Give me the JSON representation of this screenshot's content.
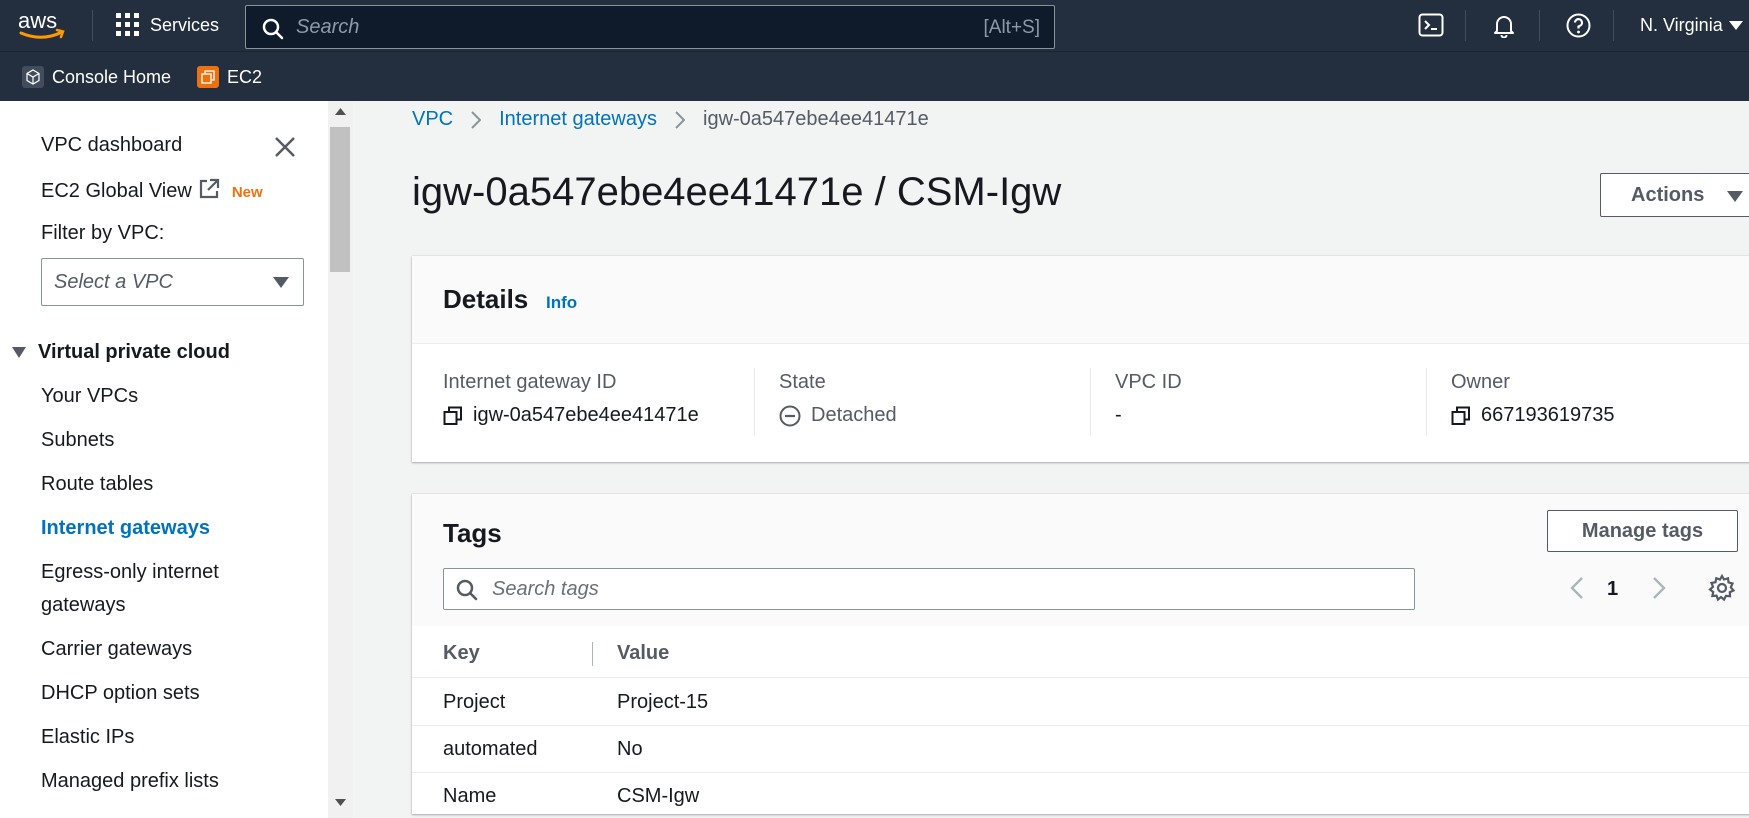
{
  "topnav": {
    "logo_text": "aws",
    "services_label": "Services",
    "search_placeholder": "Search",
    "search_shortcut": "[Alt+S]",
    "region": "N. Virginia"
  },
  "favorites": [
    {
      "label": "Console Home",
      "icon": "cube-icon"
    },
    {
      "label": "EC2",
      "icon": "ec2-icon",
      "color": "#ec7211"
    }
  ],
  "sidebar": {
    "vpc_dashboard": "VPC dashboard",
    "ec2_global_view": "EC2 Global View",
    "new_badge": "New",
    "filter_label": "Filter by VPC:",
    "filter_placeholder": "Select a VPC",
    "section": "Virtual private cloud",
    "items": [
      {
        "label": "Your VPCs"
      },
      {
        "label": "Subnets"
      },
      {
        "label": "Route tables"
      },
      {
        "label": "Internet gateways",
        "active": true
      },
      {
        "label": "Egress-only internet gateways"
      },
      {
        "label": "Carrier gateways"
      },
      {
        "label": "DHCP option sets"
      },
      {
        "label": "Elastic IPs"
      },
      {
        "label": "Managed prefix lists"
      }
    ]
  },
  "breadcrumb": {
    "root": "VPC",
    "section": "Internet gateways",
    "current": "igw-0a547ebe4ee41471e"
  },
  "page": {
    "title": "igw-0a547ebe4ee41471e / CSM-Igw",
    "actions_label": "Actions"
  },
  "details": {
    "heading": "Details",
    "info": "Info",
    "fields": {
      "igw_label": "Internet gateway ID",
      "igw_value": "igw-0a547ebe4ee41471e",
      "state_label": "State",
      "state_value": "Detached",
      "vpc_label": "VPC ID",
      "vpc_value": "-",
      "owner_label": "Owner",
      "owner_value": "667193619735"
    }
  },
  "tags": {
    "heading": "Tags",
    "manage_label": "Manage tags",
    "search_placeholder": "Search tags",
    "page": "1",
    "columns": {
      "key": "Key",
      "value": "Value"
    },
    "rows": [
      {
        "key": "Project",
        "value": "Project-15"
      },
      {
        "key": "automated",
        "value": "No"
      },
      {
        "key": "Name",
        "value": "CSM-Igw"
      }
    ]
  },
  "colors": {
    "nav_bg": "#232f3e",
    "link": "#0073bb",
    "new_badge": "#ec7211",
    "page_bg": "#f2f3f3"
  }
}
